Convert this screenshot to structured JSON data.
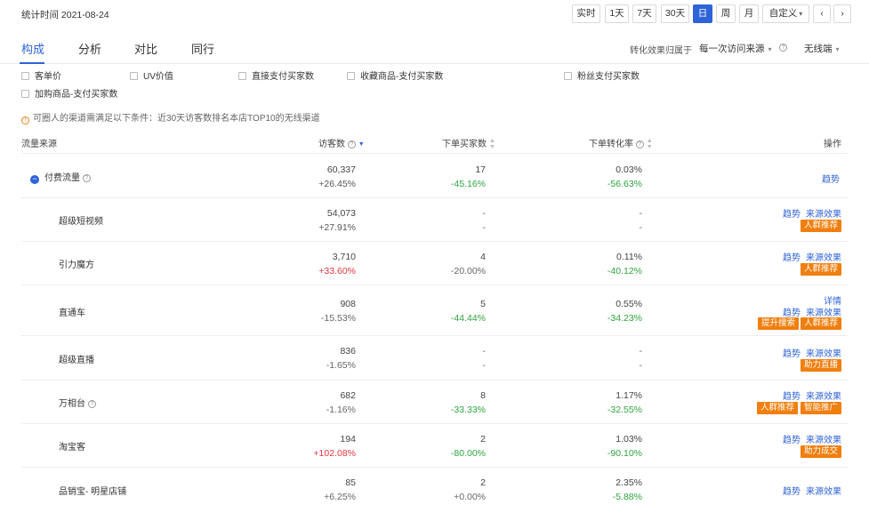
{
  "stat_time": "统计时间 2021-08-24",
  "range_buttons": [
    "实时",
    "1天",
    "7天",
    "30天",
    "日",
    "周",
    "月",
    "自定义",
    "‹",
    "›"
  ],
  "tabs": [
    "构成",
    "分析",
    "对比",
    "同行"
  ],
  "attribution": {
    "label": "转化效果归属于",
    "value": "每一次访问来源",
    "device": "无线端"
  },
  "metric_checkboxes": [
    "客单价",
    "UV价值",
    "直接支付买家数",
    "收藏商品-支付买家数",
    "粉丝支付买家数",
    "加购商品-支付买家数"
  ],
  "notice": "可圈人的渠道需满足以下条件：近30天访客数排名本店TOP10的无线渠道",
  "headers": {
    "source": "流量来源",
    "visitors": "访客数",
    "buyers": "下单买家数",
    "conversion": "下单转化率",
    "actions": "操作"
  },
  "rows": [
    {
      "source": "付费流量",
      "visitors": "60,337",
      "visitors_chg": "+26.45%",
      "buyers": "17",
      "buyers_chg": "-45.16%",
      "conv": "0.03%",
      "conv_chg": "-56.63%",
      "links": [
        "趋势"
      ],
      "tags": []
    },
    {
      "source": "超级短视频",
      "visitors": "54,073",
      "visitors_chg": "+27.91%",
      "buyers": "-",
      "buyers_chg": "-",
      "conv": "-",
      "conv_chg": "-",
      "links": [
        "趋势",
        "来源效果"
      ],
      "tags": [
        "人群推荐"
      ]
    },
    {
      "source": "引力魔方",
      "visitors": "3,710",
      "visitors_chg": "+33.60%",
      "buyers": "4",
      "buyers_chg": "-20.00%",
      "conv": "0.11%",
      "conv_chg": "-40.12%",
      "links": [
        "趋势",
        "来源效果"
      ],
      "tags": [
        "人群推荐"
      ]
    },
    {
      "source": "直通车",
      "visitors": "908",
      "visitors_chg": "-15.53%",
      "buyers": "5",
      "buyers_chg": "-44.44%",
      "conv": "0.55%",
      "conv_chg": "-34.23%",
      "detail": "详情",
      "links": [
        "趋势",
        "来源效果"
      ],
      "tags": [
        "提升搜索",
        "人群推荐"
      ]
    },
    {
      "source": "超级直播",
      "visitors": "836",
      "visitors_chg": "-1.65%",
      "buyers": "-",
      "buyers_chg": "-",
      "conv": "-",
      "conv_chg": "-",
      "links": [
        "趋势",
        "来源效果"
      ],
      "tags": [
        "助力直播"
      ]
    },
    {
      "source": "万相台",
      "visitors": "682",
      "visitors_chg": "-1.16%",
      "buyers": "8",
      "buyers_chg": "-33.33%",
      "conv": "1.17%",
      "conv_chg": "-32.55%",
      "links": [
        "趋势",
        "来源效果"
      ],
      "tags": [
        "人群推荐",
        "智能推广"
      ]
    },
    {
      "source": "淘宝客",
      "visitors": "194",
      "visitors_chg": "+102.08%",
      "buyers": "2",
      "buyers_chg": "-80.00%",
      "conv": "1.03%",
      "conv_chg": "-90.10%",
      "links": [
        "趋势",
        "来源效果"
      ],
      "tags": [
        "助力成交"
      ]
    },
    {
      "source": "品销宝- 明星店铺",
      "visitors": "85",
      "visitors_chg": "+6.25%",
      "buyers": "2",
      "buyers_chg": "+0.00%",
      "conv": "2.35%",
      "conv_chg": "-5.88%",
      "links": [
        "趋势",
        "来源效果"
      ],
      "tags": []
    }
  ],
  "colors": {
    "accent": "#2f63d8",
    "up": "#e5363f",
    "down": "#2ea43f",
    "tag": "#f07f0e"
  }
}
